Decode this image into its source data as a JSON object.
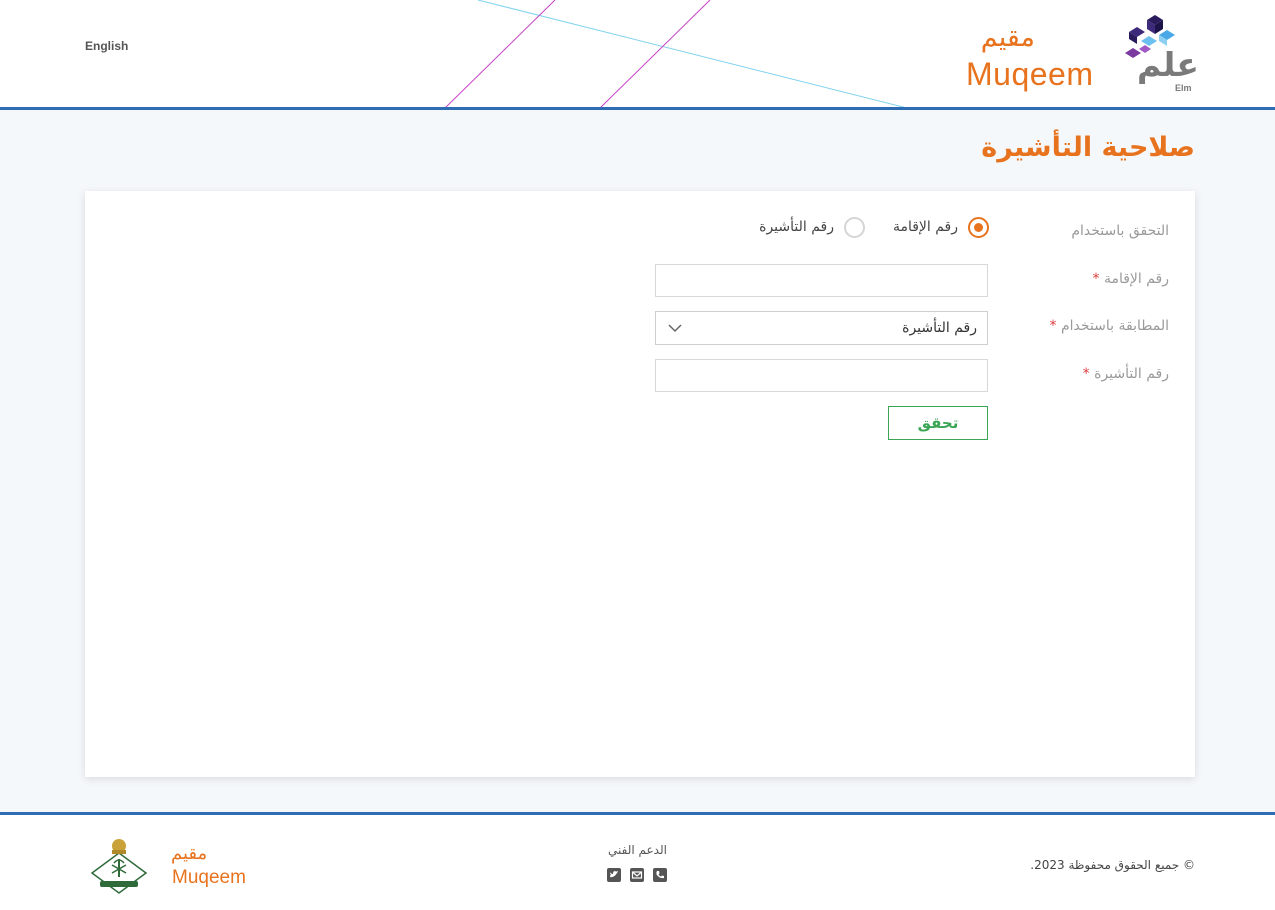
{
  "header": {
    "language_link": "English",
    "brand_ar": "مقيم",
    "brand_en": "Muqeem",
    "partner_ar": "علم",
    "partner_en": "Elm"
  },
  "page": {
    "title": "صلاحية التأشيرة"
  },
  "form": {
    "verify_label": "التحقق باستخدام",
    "radio_options": [
      {
        "label": "رقم الإقامة",
        "checked": true
      },
      {
        "label": "رقم التأشيرة",
        "checked": false
      }
    ],
    "iqama_label": "رقم الإقامة",
    "iqama_value": "",
    "match_label": "المطابقة باستخدام",
    "match_selected": "رقم التأشيرة",
    "visa_label": "رقم التأشيرة",
    "visa_value": "",
    "required_mark": "*",
    "submit_label": "تحقق"
  },
  "footer": {
    "brand_ar": "مقيم",
    "brand_en": "Muqeem",
    "support_title": "الدعم الفني",
    "support_icons": [
      "phone-icon",
      "envelope-icon",
      "twitter-icon"
    ],
    "copyright": "© جميع الحقوق محفوظة 2023."
  },
  "colors": {
    "accent": "#e8731e",
    "border_blue": "#2e6db4",
    "submit_green": "#3aa655"
  }
}
